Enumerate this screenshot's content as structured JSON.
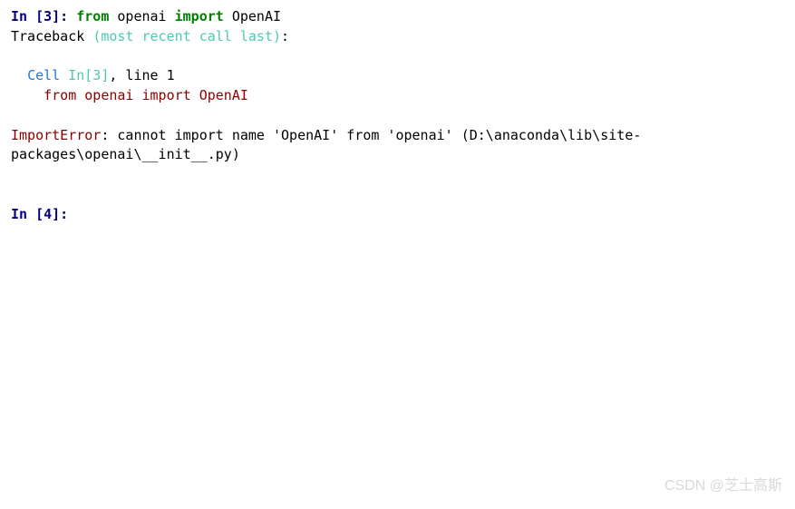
{
  "cell3": {
    "in_prompt_prefix": "In [",
    "in_prompt_num": "3",
    "in_prompt_suffix": "]: ",
    "kw_from": "from",
    "sp1": " ",
    "mod_openai": "openai",
    "sp2": " ",
    "kw_import": "import",
    "sp3": " ",
    "cls_openai": "OpenAI"
  },
  "traceback": {
    "header_prefix": "Traceback ",
    "header_paren": "(most recent call last)",
    "header_colon": ":",
    "cell_word": "Cell ",
    "cell_ref": "In[3]",
    "cell_line": ", line 1",
    "code_line": "    from openai import OpenAI",
    "err_name": "ImportError",
    "err_colon": ": ",
    "err_msg": "cannot import name 'OpenAI' from 'openai' (D:\\anaconda\\lib\\site-packages\\openai\\__init__.py)"
  },
  "cell4": {
    "in_prompt_prefix": "In [",
    "in_prompt_num": "4",
    "in_prompt_suffix": "]: "
  },
  "watermark": "CSDN @芝士高斯"
}
